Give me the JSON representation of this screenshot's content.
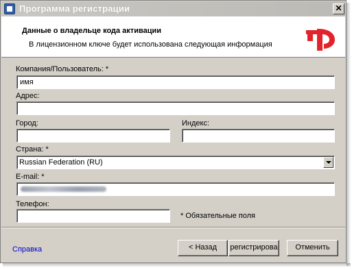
{
  "window": {
    "title": "Программа регистрации",
    "close_label": "✕"
  },
  "header": {
    "title": "Данные о владельце кода активации",
    "subtitle": "В лицензионном ключе будет использована следующая информация",
    "brand_colors": {
      "red": "#e3232b"
    }
  },
  "form": {
    "company_label": "Компания/Пользователь: *",
    "company_value": "имя",
    "address_label": "Адрес:",
    "address_value": "",
    "city_label": "Город:",
    "city_value": "",
    "index_label": "Индекс:",
    "index_value": "",
    "country_label": "Страна: *",
    "country_value": "Russian Federation (RU)",
    "email_label": "E-mail: *",
    "email_value": "",
    "phone_label": "Телефон:",
    "phone_value": "",
    "required_note": "* Обязательные поля"
  },
  "footer": {
    "help_link": "Справка",
    "back_label": "< Назад",
    "register_label": "регистрирова",
    "cancel_label": "Отменить"
  },
  "icons": {
    "app": "app-icon",
    "logo": "brand-logo-icon",
    "dropdown": "chevron-down-icon"
  }
}
